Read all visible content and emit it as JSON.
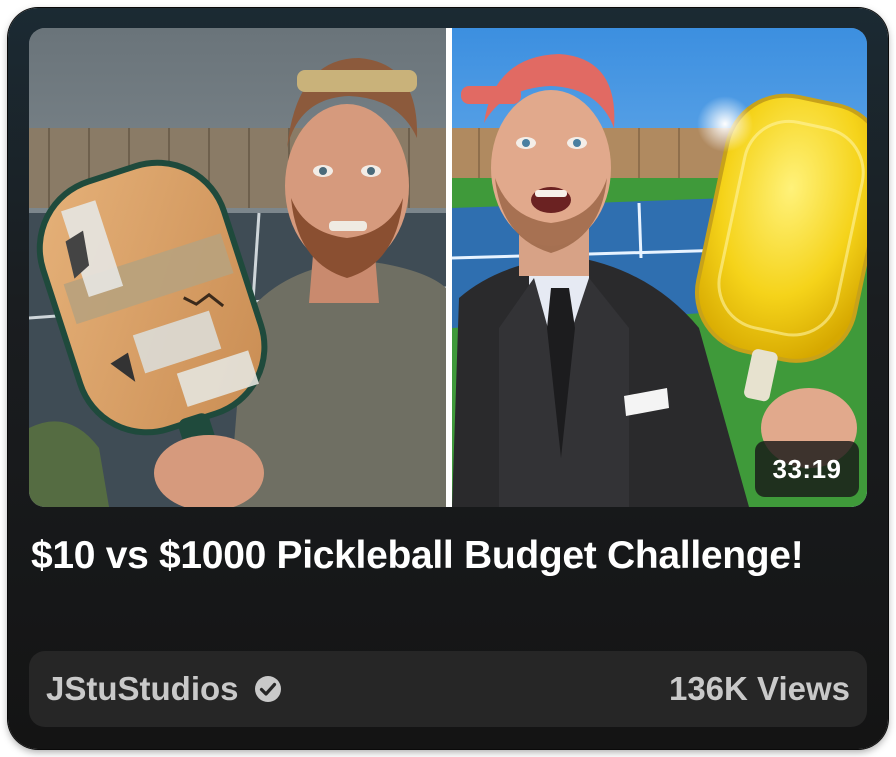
{
  "video": {
    "title": "$10 vs $1000 Pickleball Budget Challenge!",
    "duration": "33:19",
    "channel": "JStuStudios",
    "channel_verified": true,
    "views": "136K Views"
  },
  "icons": {
    "verified": "verified-check-icon"
  },
  "colors": {
    "card_bg": "#1a1d20",
    "meta_bar_bg": "#262626",
    "title_text": "#ffffff",
    "meta_text": "#c9c9c9",
    "duration_bg": "#191919"
  }
}
